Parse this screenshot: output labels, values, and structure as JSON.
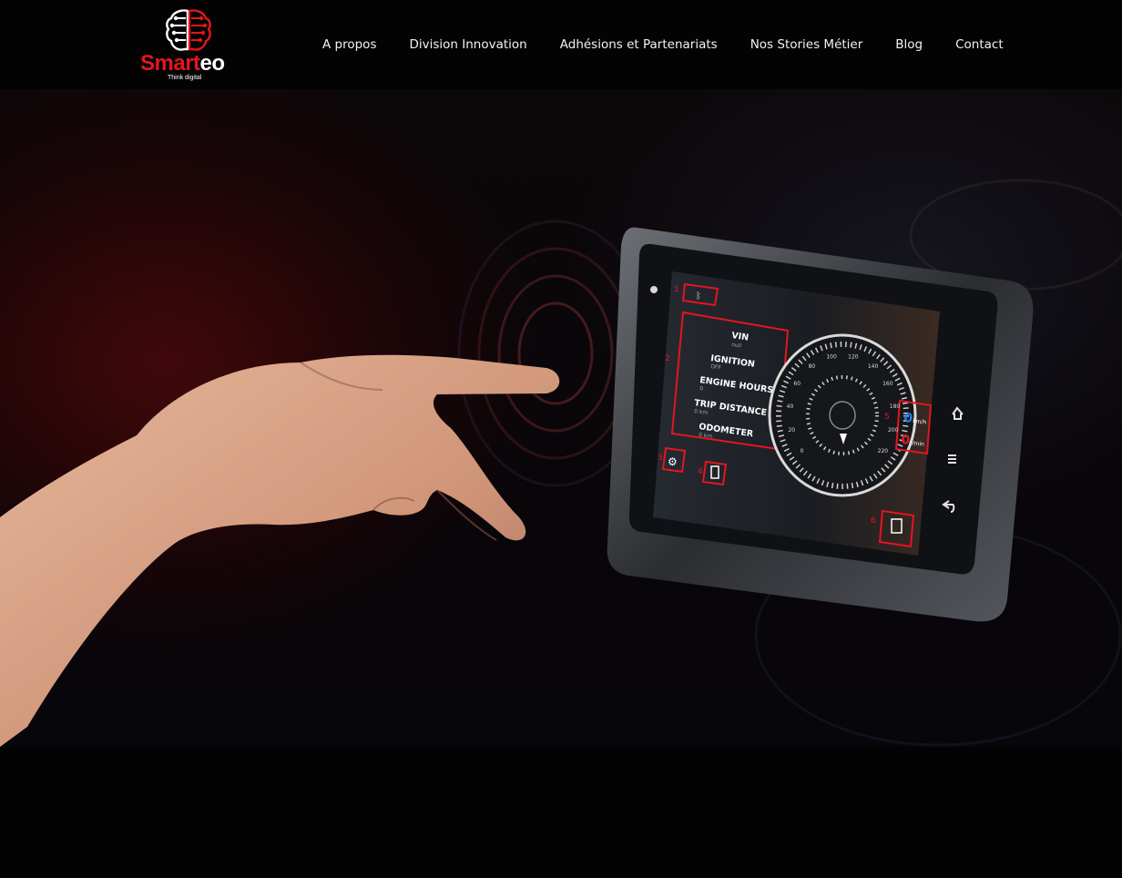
{
  "brand": {
    "name_part_red": "Smart",
    "name_part_white": "eo",
    "tagline": "Think digital",
    "colors": {
      "red": "#e3161f",
      "white": "#ffffff"
    },
    "logo_icon": "brain-circuit-icon"
  },
  "nav": {
    "items": [
      {
        "label": "A propos"
      },
      {
        "label": "Division Innovation"
      },
      {
        "label": "Adhésions et Partenariats"
      },
      {
        "label": "Nos Stories Métier"
      },
      {
        "label": "Blog"
      },
      {
        "label": "Contact"
      }
    ]
  },
  "hero": {
    "device_screen": {
      "menu": [
        {
          "label": "VIN",
          "value": "null"
        },
        {
          "label": "IGNITION",
          "value": "OFF"
        },
        {
          "label": "ENGINE HOURS",
          "value": "0"
        },
        {
          "label": "TRIP DISTANCE",
          "value": "0 km"
        },
        {
          "label": "ODOMETER",
          "value": "0 km"
        }
      ],
      "speed_value": "0",
      "speed_unit": "km/h",
      "rpm_value": "0",
      "rpm_unit": "r/min",
      "gauge_ticks": [
        "0",
        "20",
        "40",
        "60",
        "80",
        "100",
        "120",
        "140",
        "160",
        "180",
        "200",
        "220"
      ],
      "callouts": [
        "1",
        "2",
        "3",
        "4",
        "5",
        "6"
      ]
    },
    "side_icons": [
      "home-icon",
      "menu-icon",
      "back-icon"
    ]
  }
}
